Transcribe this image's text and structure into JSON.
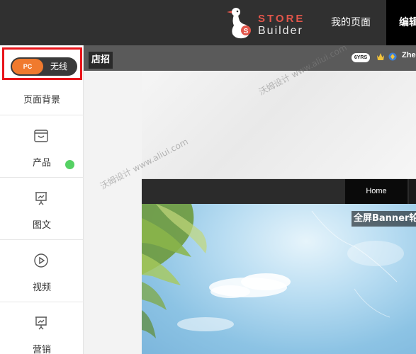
{
  "topbar": {
    "logo_line1": "STORE",
    "logo_line2": "Builder",
    "nav_my_page": "我的页面",
    "nav_edit": "编辑"
  },
  "sidebar": {
    "toggle": {
      "pc_label": "PC",
      "wireless_label": "无线"
    },
    "items": [
      {
        "label": "页面背景"
      },
      {
        "label": "产品",
        "icon": "bag-icon"
      },
      {
        "label": "图文",
        "icon": "presentation-icon"
      },
      {
        "label": "视频",
        "icon": "play-icon"
      },
      {
        "label": "营销",
        "icon": "presentation-icon"
      }
    ]
  },
  "canvas": {
    "shop_sign_label": "店招",
    "years_badge": "6YRS",
    "store_name": "Zhe",
    "nav_home": "Home",
    "banner_title": "全屏Banner轮播"
  },
  "watermarks": [
    "沃姆设计 www.aliui.com",
    "沃姆设计 www.aliui.com"
  ],
  "colors": {
    "topbar_bg": "#303030",
    "accent_orange": "#f07a2e",
    "logo_red": "#e2564b",
    "highlight_border": "#e8141a",
    "status_green": "#55d163"
  }
}
